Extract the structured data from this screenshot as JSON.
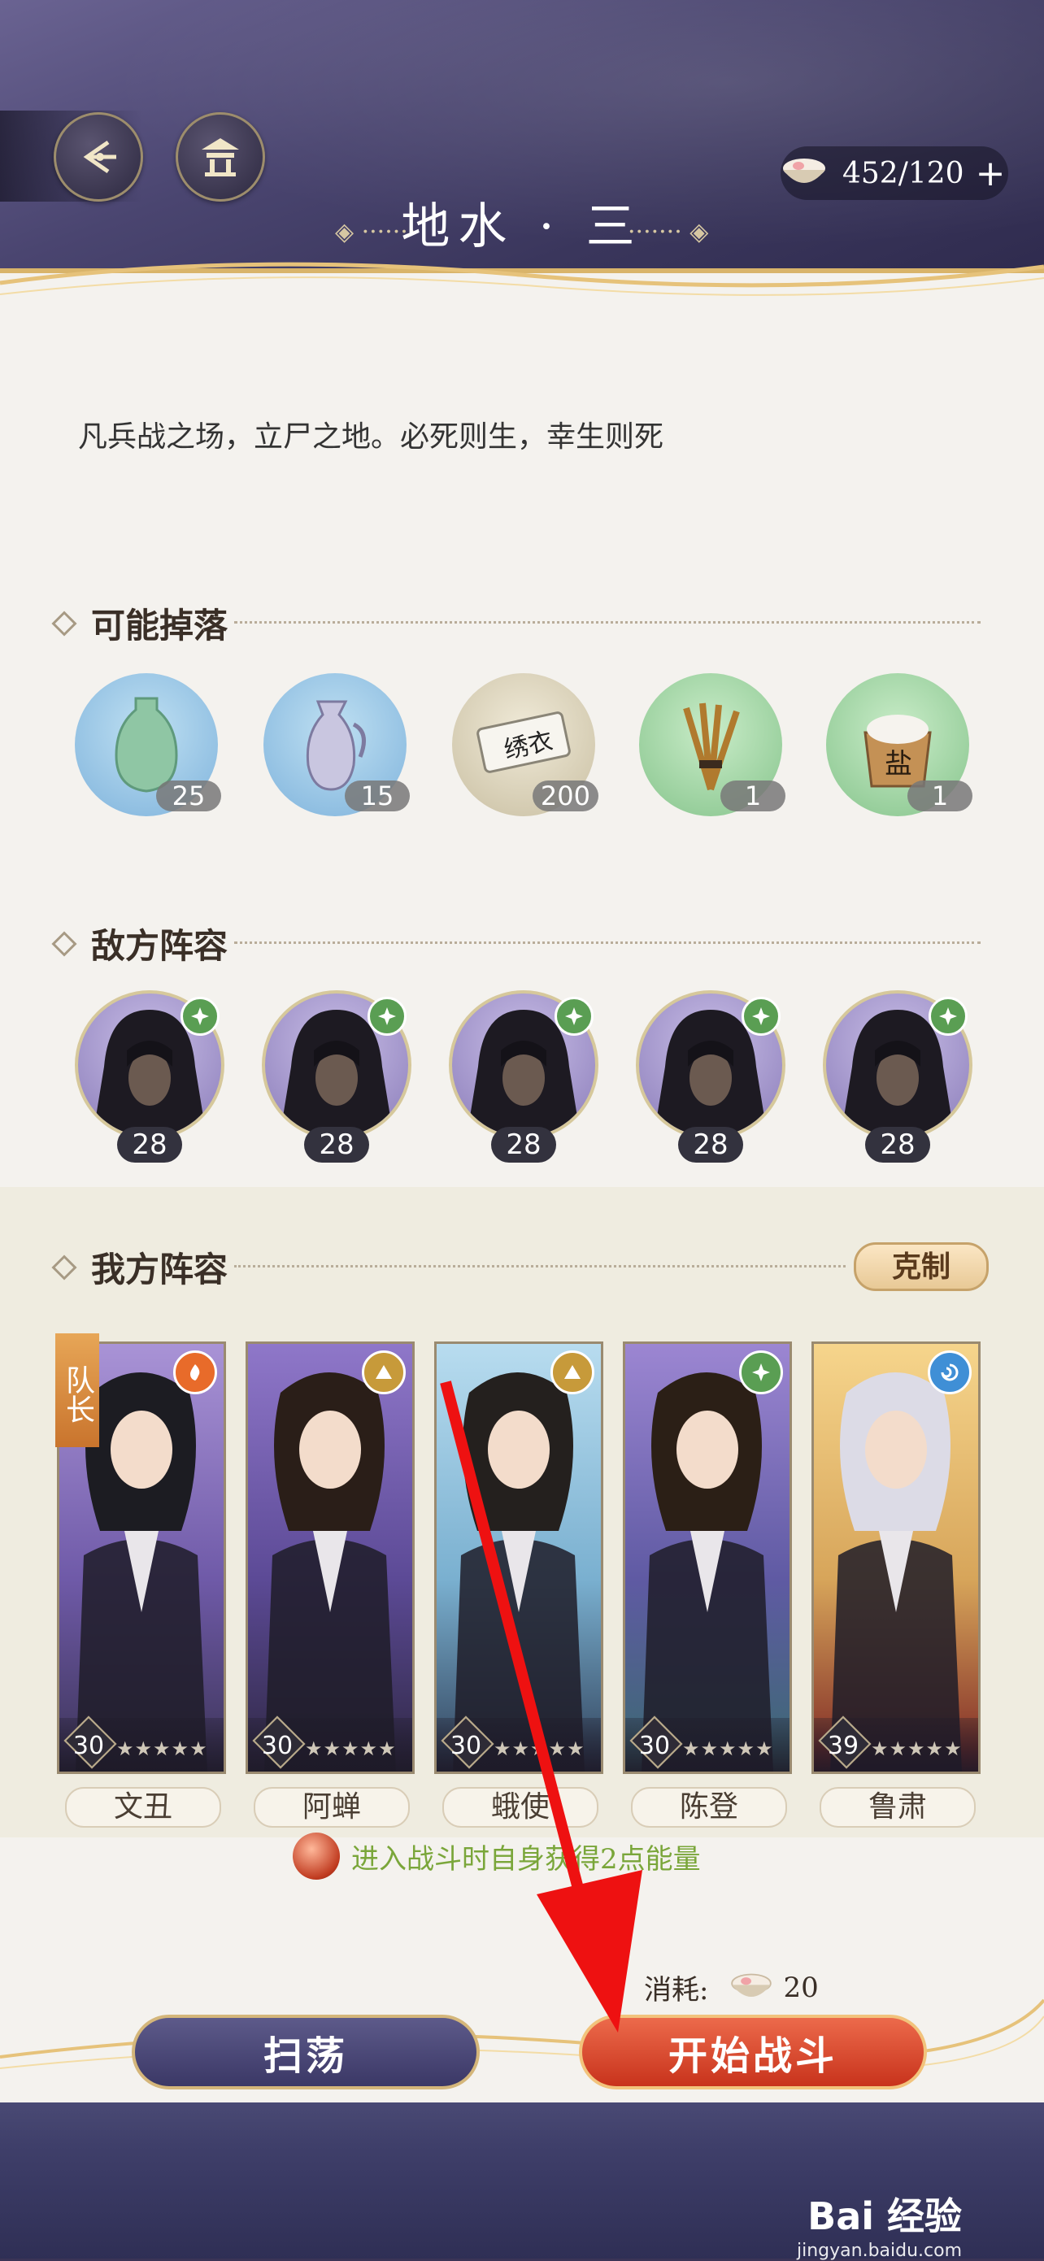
{
  "header": {
    "title": "地水 · 三",
    "stamina": "452/120",
    "stamina_plus": "+"
  },
  "description": "凡兵战之场，立尸之地。必死则生，幸生则死",
  "drops": {
    "heading": "可能掉落",
    "items": [
      {
        "icon": "green-vase-icon",
        "count": "25"
      },
      {
        "icon": "silver-ewer-icon",
        "count": "15"
      },
      {
        "icon": "embroidered-scroll-icon",
        "label": "绣衣",
        "count": "200"
      },
      {
        "icon": "wheat-bundle-icon",
        "count": "1"
      },
      {
        "icon": "salt-box-icon",
        "label": "盐",
        "count": "1"
      }
    ]
  },
  "enemies": {
    "heading": "敌方阵容",
    "items": [
      {
        "level": "28",
        "element": "wind"
      },
      {
        "level": "28",
        "element": "wind"
      },
      {
        "level": "28",
        "element": "wind"
      },
      {
        "level": "28",
        "element": "wind"
      },
      {
        "level": "28",
        "element": "wind"
      }
    ]
  },
  "allies": {
    "heading": "我方阵容",
    "counter_label": "克制",
    "captain_label": "队长",
    "heroes": [
      {
        "name": "文丑",
        "level": "30",
        "element": "fire",
        "stars": "★★★★★"
      },
      {
        "name": "阿蝉",
        "level": "30",
        "element": "earth",
        "stars": "★★★★★"
      },
      {
        "name": "蛾使",
        "level": "30",
        "element": "earth",
        "stars": "★★★★★"
      },
      {
        "name": "陈登",
        "level": "30",
        "element": "wind",
        "stars": "★★★★★"
      },
      {
        "name": "鲁肃",
        "level": "39",
        "element": "water",
        "stars": "★★★★★"
      }
    ],
    "buff_text": "进入战斗时自身获得2点能量"
  },
  "cost": {
    "label": "消耗:",
    "amount": "20"
  },
  "buttons": {
    "sweep": "扫荡",
    "start": "开始战斗"
  },
  "watermark": {
    "brand": "Bai 经验",
    "url": "jingyan.baidu.com"
  },
  "colors": {
    "accent_gold": "#d9b46a",
    "start_red": "#c8331c",
    "sweep_purple": "#3b3866",
    "arrow_red": "#ee1111"
  }
}
